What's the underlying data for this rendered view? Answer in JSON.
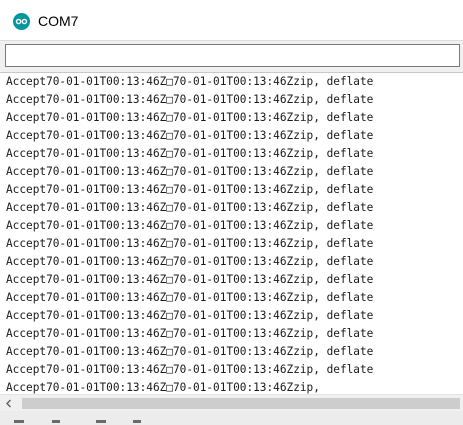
{
  "window": {
    "title": "COM7",
    "icon": "arduino-infinity-icon"
  },
  "send": {
    "value": "",
    "placeholder": ""
  },
  "output": {
    "lines": [
      "Accept70-01-01T00:13:46Z□70-01-01T00:13:46Zzip, deflate",
      "Accept70-01-01T00:13:46Z□70-01-01T00:13:46Zzip, deflate",
      "Accept70-01-01T00:13:46Z□70-01-01T00:13:46Zzip, deflate",
      "Accept70-01-01T00:13:46Z□70-01-01T00:13:46Zzip, deflate",
      "Accept70-01-01T00:13:46Z□70-01-01T00:13:46Zzip, deflate",
      "Accept70-01-01T00:13:46Z□70-01-01T00:13:46Zzip, deflate",
      "Accept70-01-01T00:13:46Z□70-01-01T00:13:46Zzip, deflate",
      "Accept70-01-01T00:13:46Z□70-01-01T00:13:46Zzip, deflate",
      "Accept70-01-01T00:13:46Z□70-01-01T00:13:46Zzip, deflate",
      "Accept70-01-01T00:13:46Z□70-01-01T00:13:46Zzip, deflate",
      "Accept70-01-01T00:13:46Z□70-01-01T00:13:46Zzip, deflate",
      "Accept70-01-01T00:13:46Z□70-01-01T00:13:46Zzip, deflate",
      "Accept70-01-01T00:13:46Z□70-01-01T00:13:46Zzip, deflate",
      "Accept70-01-01T00:13:46Z□70-01-01T00:13:46Zzip, deflate",
      "Accept70-01-01T00:13:46Z□70-01-01T00:13:46Zzip, deflate",
      "Accept70-01-01T00:13:46Z□70-01-01T00:13:46Zzip, deflate",
      "Accept70-01-01T00:13:46Z□70-01-01T00:13:46Zzip, deflate",
      "Accept70-01-01T00:13:46Z□70-01-01T00:13:46Zzip,"
    ]
  },
  "scrollbar": {
    "left_icon": "chevron-left-icon"
  },
  "colors": {
    "icon_teal": "#00979d",
    "scroll_thumb": "#cdcdcd"
  }
}
